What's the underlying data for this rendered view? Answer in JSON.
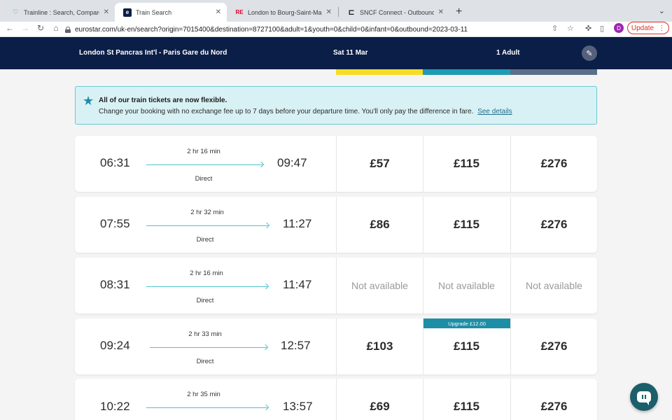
{
  "browser": {
    "tabs": [
      {
        "title": "Trainline : Search, Compare & S",
        "favicon": "trainline-icon",
        "favicon_color": "#00a88f"
      },
      {
        "title": "Train Search",
        "favicon": "eurostar-icon",
        "favicon_color": "#0b1e47"
      },
      {
        "title": "London to Bourg-Saint-Mauric",
        "favicon": "re-icon",
        "favicon_color": "#e4002b"
      },
      {
        "title": "SNCF Connect - Outbound jou",
        "favicon": "sncf-icon",
        "favicon_color": "#0c131f"
      }
    ],
    "url": "eurostar.com/uk-en/search?origin=7015400&destination=8727100&adult=1&youth=0&child=0&infant=0&outbound=2023-03-11",
    "profile_initial": "D",
    "update_label": "Update"
  },
  "header": {
    "route": "London St Pancras Int'l - Paris Gare du Nord",
    "date": "Sat 11 Mar",
    "passengers": "1 Adult"
  },
  "class_colors": [
    "#f7dd25",
    "#1e9bb5",
    "#5b6f8a"
  ],
  "notice": {
    "title": "All of our train tickets are now flexible.",
    "body": "Change your booking with no exchange fee up to 7 days before your departure time. You'll only pay the difference in fare.",
    "link": "See details"
  },
  "journeys": [
    {
      "dep": "06:31",
      "arr": "09:47",
      "duration": "2 hr 16 min",
      "type": "Direct",
      "fares": [
        "£57",
        "£115",
        "£276"
      ]
    },
    {
      "dep": "07:55",
      "arr": "11:27",
      "duration": "2 hr 32 min",
      "type": "Direct",
      "fares": [
        "£86",
        "£115",
        "£276"
      ]
    },
    {
      "dep": "08:31",
      "arr": "11:47",
      "duration": "2 hr 16 min",
      "type": "Direct",
      "fares": [
        "Not available",
        "Not available",
        "Not available"
      ]
    },
    {
      "dep": "09:24",
      "arr": "12:57",
      "duration": "2 hr 33 min",
      "type": "Direct",
      "fares": [
        "£103",
        "£115",
        "£276"
      ]
    },
    {
      "dep": "10:22",
      "arr": "13:57",
      "duration": "2 hr 35 min",
      "type": "",
      "fares": [
        "£69",
        "£115",
        "£276"
      ]
    }
  ],
  "upgrade_badge": "Upgrade £12.00"
}
